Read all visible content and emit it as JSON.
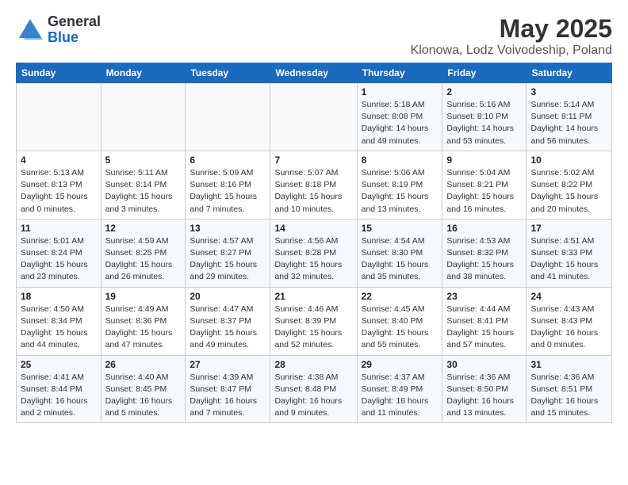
{
  "header": {
    "logo_general": "General",
    "logo_blue": "Blue",
    "title": "May 2025",
    "subtitle": "Klonowa, Lodz Voivodeship, Poland"
  },
  "weekdays": [
    "Sunday",
    "Monday",
    "Tuesday",
    "Wednesday",
    "Thursday",
    "Friday",
    "Saturday"
  ],
  "weeks": [
    [
      {
        "day": "",
        "detail": ""
      },
      {
        "day": "",
        "detail": ""
      },
      {
        "day": "",
        "detail": ""
      },
      {
        "day": "",
        "detail": ""
      },
      {
        "day": "1",
        "detail": "Sunrise: 5:18 AM\nSunset: 8:08 PM\nDaylight: 14 hours\nand 49 minutes."
      },
      {
        "day": "2",
        "detail": "Sunrise: 5:16 AM\nSunset: 8:10 PM\nDaylight: 14 hours\nand 53 minutes."
      },
      {
        "day": "3",
        "detail": "Sunrise: 5:14 AM\nSunset: 8:11 PM\nDaylight: 14 hours\nand 56 minutes."
      }
    ],
    [
      {
        "day": "4",
        "detail": "Sunrise: 5:13 AM\nSunset: 8:13 PM\nDaylight: 15 hours\nand 0 minutes."
      },
      {
        "day": "5",
        "detail": "Sunrise: 5:11 AM\nSunset: 8:14 PM\nDaylight: 15 hours\nand 3 minutes."
      },
      {
        "day": "6",
        "detail": "Sunrise: 5:09 AM\nSunset: 8:16 PM\nDaylight: 15 hours\nand 7 minutes."
      },
      {
        "day": "7",
        "detail": "Sunrise: 5:07 AM\nSunset: 8:18 PM\nDaylight: 15 hours\nand 10 minutes."
      },
      {
        "day": "8",
        "detail": "Sunrise: 5:06 AM\nSunset: 8:19 PM\nDaylight: 15 hours\nand 13 minutes."
      },
      {
        "day": "9",
        "detail": "Sunrise: 5:04 AM\nSunset: 8:21 PM\nDaylight: 15 hours\nand 16 minutes."
      },
      {
        "day": "10",
        "detail": "Sunrise: 5:02 AM\nSunset: 8:22 PM\nDaylight: 15 hours\nand 20 minutes."
      }
    ],
    [
      {
        "day": "11",
        "detail": "Sunrise: 5:01 AM\nSunset: 8:24 PM\nDaylight: 15 hours\nand 23 minutes."
      },
      {
        "day": "12",
        "detail": "Sunrise: 4:59 AM\nSunset: 8:25 PM\nDaylight: 15 hours\nand 26 minutes."
      },
      {
        "day": "13",
        "detail": "Sunrise: 4:57 AM\nSunset: 8:27 PM\nDaylight: 15 hours\nand 29 minutes."
      },
      {
        "day": "14",
        "detail": "Sunrise: 4:56 AM\nSunset: 8:28 PM\nDaylight: 15 hours\nand 32 minutes."
      },
      {
        "day": "15",
        "detail": "Sunrise: 4:54 AM\nSunset: 8:30 PM\nDaylight: 15 hours\nand 35 minutes."
      },
      {
        "day": "16",
        "detail": "Sunrise: 4:53 AM\nSunset: 8:32 PM\nDaylight: 15 hours\nand 38 minutes."
      },
      {
        "day": "17",
        "detail": "Sunrise: 4:51 AM\nSunset: 8:33 PM\nDaylight: 15 hours\nand 41 minutes."
      }
    ],
    [
      {
        "day": "18",
        "detail": "Sunrise: 4:50 AM\nSunset: 8:34 PM\nDaylight: 15 hours\nand 44 minutes."
      },
      {
        "day": "19",
        "detail": "Sunrise: 4:49 AM\nSunset: 8:36 PM\nDaylight: 15 hours\nand 47 minutes."
      },
      {
        "day": "20",
        "detail": "Sunrise: 4:47 AM\nSunset: 8:37 PM\nDaylight: 15 hours\nand 49 minutes."
      },
      {
        "day": "21",
        "detail": "Sunrise: 4:46 AM\nSunset: 8:39 PM\nDaylight: 15 hours\nand 52 minutes."
      },
      {
        "day": "22",
        "detail": "Sunrise: 4:45 AM\nSunset: 8:40 PM\nDaylight: 15 hours\nand 55 minutes."
      },
      {
        "day": "23",
        "detail": "Sunrise: 4:44 AM\nSunset: 8:41 PM\nDaylight: 15 hours\nand 57 minutes."
      },
      {
        "day": "24",
        "detail": "Sunrise: 4:43 AM\nSunset: 8:43 PM\nDaylight: 16 hours\nand 0 minutes."
      }
    ],
    [
      {
        "day": "25",
        "detail": "Sunrise: 4:41 AM\nSunset: 8:44 PM\nDaylight: 16 hours\nand 2 minutes."
      },
      {
        "day": "26",
        "detail": "Sunrise: 4:40 AM\nSunset: 8:45 PM\nDaylight: 16 hours\nand 5 minutes."
      },
      {
        "day": "27",
        "detail": "Sunrise: 4:39 AM\nSunset: 8:47 PM\nDaylight: 16 hours\nand 7 minutes."
      },
      {
        "day": "28",
        "detail": "Sunrise: 4:38 AM\nSunset: 8:48 PM\nDaylight: 16 hours\nand 9 minutes."
      },
      {
        "day": "29",
        "detail": "Sunrise: 4:37 AM\nSunset: 8:49 PM\nDaylight: 16 hours\nand 11 minutes."
      },
      {
        "day": "30",
        "detail": "Sunrise: 4:36 AM\nSunset: 8:50 PM\nDaylight: 16 hours\nand 13 minutes."
      },
      {
        "day": "31",
        "detail": "Sunrise: 4:36 AM\nSunset: 8:51 PM\nDaylight: 16 hours\nand 15 minutes."
      }
    ]
  ]
}
